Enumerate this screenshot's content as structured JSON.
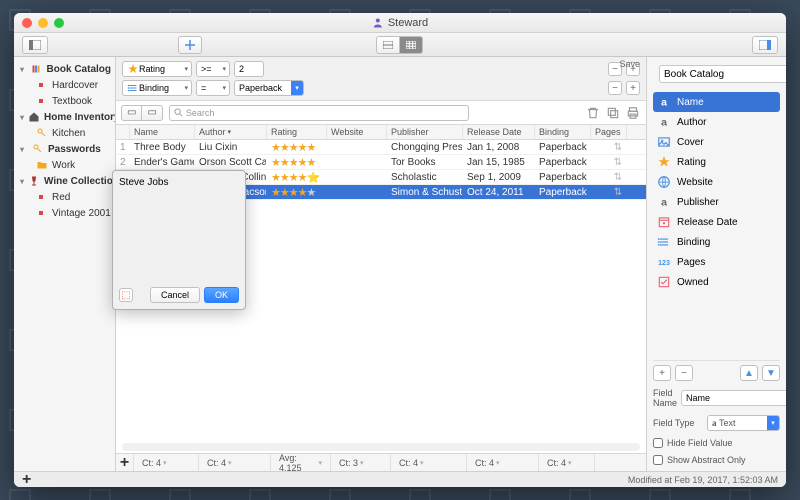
{
  "window": {
    "title": "Steward"
  },
  "toolbar": {
    "save": "Save"
  },
  "sidebar": {
    "groups": [
      {
        "label": "Book Catalog",
        "icon": "books",
        "children": [
          {
            "label": "Hardcover",
            "color": "#d44"
          },
          {
            "label": "Textbook",
            "color": "#d44"
          }
        ]
      },
      {
        "label": "Home Inventory",
        "icon": "home",
        "children": [
          {
            "label": "Kitchen",
            "icon": "key"
          }
        ]
      },
      {
        "label": "Passwords",
        "icon": "key",
        "children": [
          {
            "label": "Work",
            "icon": "folder"
          }
        ]
      },
      {
        "label": "Wine Collection",
        "icon": "wine",
        "children": [
          {
            "label": "Red",
            "color": "#d44"
          },
          {
            "label": "Vintage 2001",
            "color": "#d44"
          }
        ]
      }
    ]
  },
  "filters": [
    {
      "field": "Rating",
      "icon": "star",
      "op": ">=",
      "value": "2"
    },
    {
      "field": "Binding",
      "icon": "list",
      "op": "=",
      "value": "Paperback"
    }
  ],
  "search": {
    "placeholder": "Search"
  },
  "columns": [
    "",
    "Name",
    "Author",
    "Rating",
    "Website",
    "Publisher",
    "Release Date",
    "Binding",
    "Pages"
  ],
  "rows": [
    {
      "n": "1",
      "name": "Three Body",
      "author": "Liu Cixin",
      "rating": 5,
      "pub": "Chongqing Press",
      "date": "Jan 1, 2008",
      "bind": "Paperback"
    },
    {
      "n": "2",
      "name": "Ender's Game",
      "author": "Orson Scott Card",
      "rating": 5,
      "pub": "Tor Books",
      "date": "Jan 15, 1985",
      "bind": "Paperback"
    },
    {
      "n": "3",
      "name": "Catching Fire",
      "author": "Suzanne Collins",
      "rating": 4,
      "half": true,
      "pub": "Scholastic",
      "date": "Sep 1, 2009",
      "bind": "Paperback"
    },
    {
      "n": "4",
      "name": "Steve Jobs",
      "author": "Walter Isaacson",
      "rating": 4,
      "pub": "Simon & Schuster",
      "date": "Oct 24, 2011",
      "bind": "Paperback",
      "selected": true
    }
  ],
  "stats": [
    {
      "label": "Ct: 4"
    },
    {
      "label": "Ct: 4"
    },
    {
      "label": "Avg: 4.125"
    },
    {
      "label": "Ct: 3"
    },
    {
      "label": "Ct: 4"
    },
    {
      "label": "Ct: 4"
    },
    {
      "label": "Ct: 4"
    }
  ],
  "footer": {
    "modified": "Modified at Feb 19, 2017, 1:52:03 AM"
  },
  "inspector": {
    "title": "Book Catalog",
    "fields": [
      {
        "label": "Name",
        "icon": "text",
        "active": true
      },
      {
        "label": "Author",
        "icon": "text"
      },
      {
        "label": "Cover",
        "icon": "image"
      },
      {
        "label": "Rating",
        "icon": "star"
      },
      {
        "label": "Website",
        "icon": "globe"
      },
      {
        "label": "Publisher",
        "icon": "text"
      },
      {
        "label": "Release Date",
        "icon": "calendar"
      },
      {
        "label": "Binding",
        "icon": "list"
      },
      {
        "label": "Pages",
        "icon": "number"
      },
      {
        "label": "Owned",
        "icon": "check"
      }
    ],
    "fieldName": {
      "label": "Field Name",
      "value": "Name"
    },
    "fieldType": {
      "label": "Field Type",
      "value": "Text",
      "icon": "a"
    },
    "opts": {
      "hide": "Hide Field Value",
      "abstract": "Show Abstract Only"
    }
  },
  "popup": {
    "text": "Steve Jobs",
    "cancel": "Cancel",
    "ok": "OK"
  }
}
